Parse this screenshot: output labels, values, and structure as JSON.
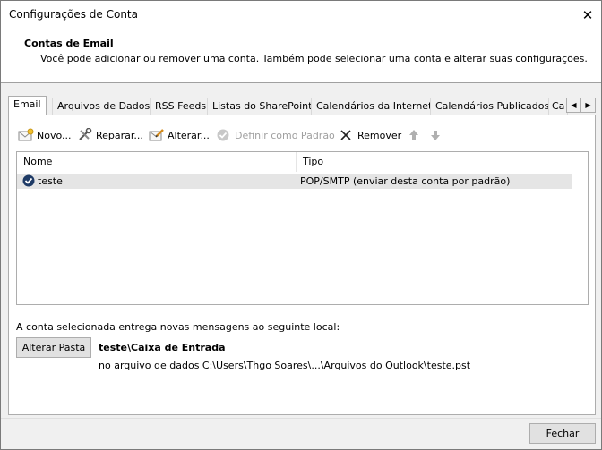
{
  "window": {
    "title": "Configurações de Conta"
  },
  "header": {
    "title": "Contas de Email",
    "description": "Você pode adicionar ou remover uma conta. Também pode selecionar uma conta e alterar suas configurações."
  },
  "tabs": [
    {
      "label": "Email",
      "active": true
    },
    {
      "label": "Arquivos de Dados",
      "active": false
    },
    {
      "label": "RSS Feeds",
      "active": false
    },
    {
      "label": "Listas do SharePoint",
      "active": false
    },
    {
      "label": "Calendários da Internet",
      "active": false
    },
    {
      "label": "Calendários Publicados",
      "active": false
    },
    {
      "label": "Ca",
      "active": false
    }
  ],
  "toolbar": {
    "new_label": "Novo...",
    "repair_label": "Reparar...",
    "change_label": "Alterar...",
    "set_default_label": "Definir como Padrão",
    "remove_label": "Remover"
  },
  "accounts_table": {
    "columns": [
      "Nome",
      "Tipo"
    ],
    "rows": [
      {
        "name": "teste",
        "type": "POP/SMTP (enviar desta conta por padrão)"
      }
    ]
  },
  "delivery": {
    "intro": "A conta selecionada entrega novas mensagens ao seguinte local:",
    "change_folder_label": "Alterar Pasta",
    "folder": "teste\\Caixa de Entrada",
    "data_file": "no arquivo de dados C:\\Users\\Thgo Soares\\...\\Arquivos do Outlook\\teste.pst"
  },
  "footer": {
    "close_label": "Fechar"
  },
  "colors": {
    "selected_row": "#e5e5e5",
    "accent": "#1e5aa8"
  }
}
